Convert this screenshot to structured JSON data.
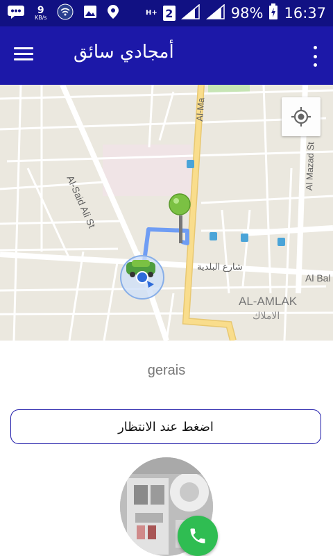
{
  "status_bar": {
    "net_speed": "9",
    "net_unit": "KB/s",
    "network_type": "H+",
    "sim_slot": "2",
    "battery": "98%",
    "time": "16:37",
    "icons": [
      "chat-icon",
      "wifi-scan-icon",
      "image-icon",
      "location-pin-icon",
      "signal-icon",
      "battery-charging-icon"
    ]
  },
  "app_bar": {
    "title": "أمجادي سائق",
    "icons": [
      "menu-icon",
      "more-vert-icon"
    ]
  },
  "map": {
    "labels": {
      "said_ali": "Al-Said Ali St",
      "al_ma": "Al-Ma",
      "al_mazad": "Al Mazad St",
      "baladia": "شارع البلدية",
      "al_bal": "Al Bal",
      "district_en": "AL-AMLAK",
      "district_ar": "الاملاك"
    },
    "colors": {
      "route": "#6f9df4",
      "main_road": "#f9dd8c",
      "pin": "#7bc143"
    }
  },
  "content": {
    "driver_name": "gerais",
    "wait_button": "اضغط عند الانتظار"
  }
}
